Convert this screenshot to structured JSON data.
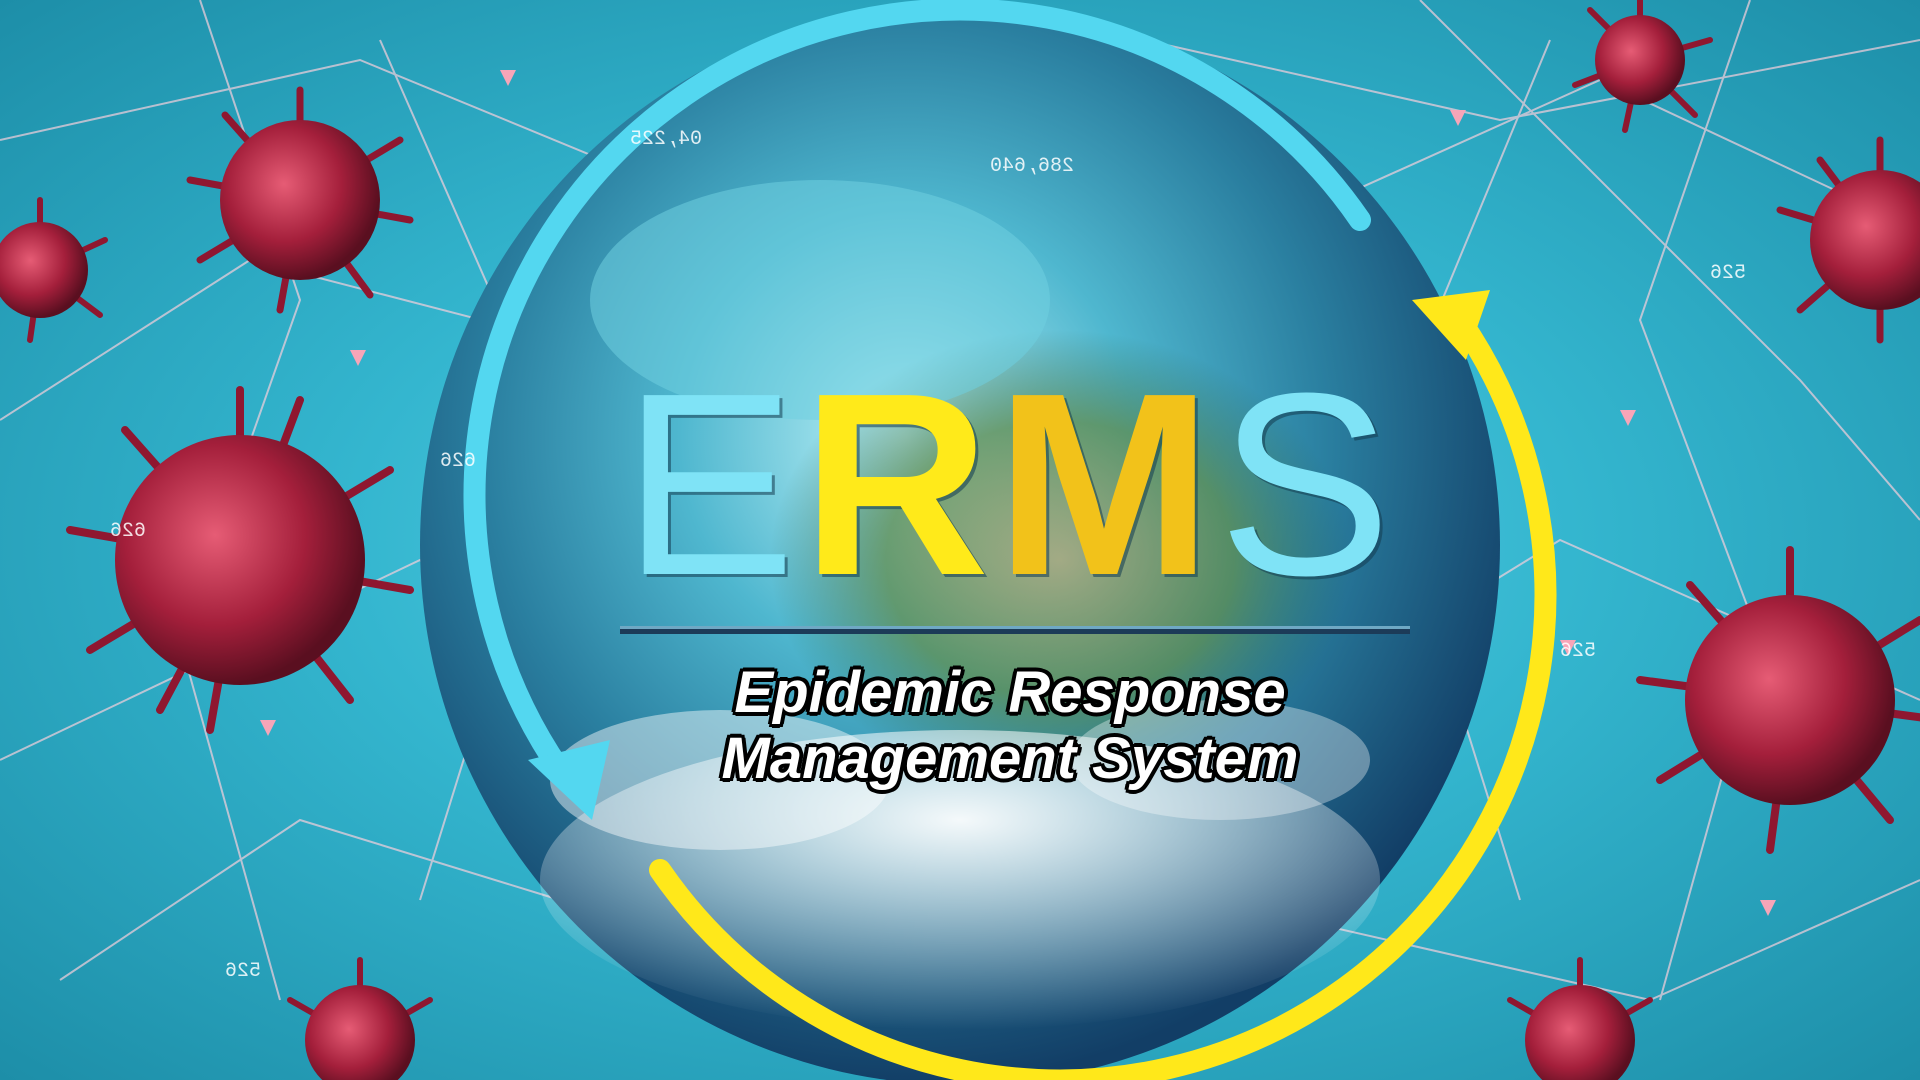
{
  "logo": {
    "letters": [
      "E",
      "R",
      "M",
      "S"
    ]
  },
  "subtitle": {
    "line1": "Epidemic Response",
    "line2": "Management System"
  },
  "hud_numbers": [
    "04,225",
    "286,640",
    "526",
    "526",
    "626",
    "626",
    "526"
  ],
  "colors": {
    "background": "#34b6cf",
    "arrow_cyan": "#53d7f0",
    "arrow_yellow": "#ffe81a",
    "letter_cyan": "#7fe3f6",
    "letter_yellow": "#ffea1a",
    "virus_red": "#b3273f",
    "network_pink": "#f7a5b8"
  },
  "icons": [
    "globe-icon",
    "virus-icon",
    "cyclic-arrows-icon",
    "network-mesh"
  ]
}
